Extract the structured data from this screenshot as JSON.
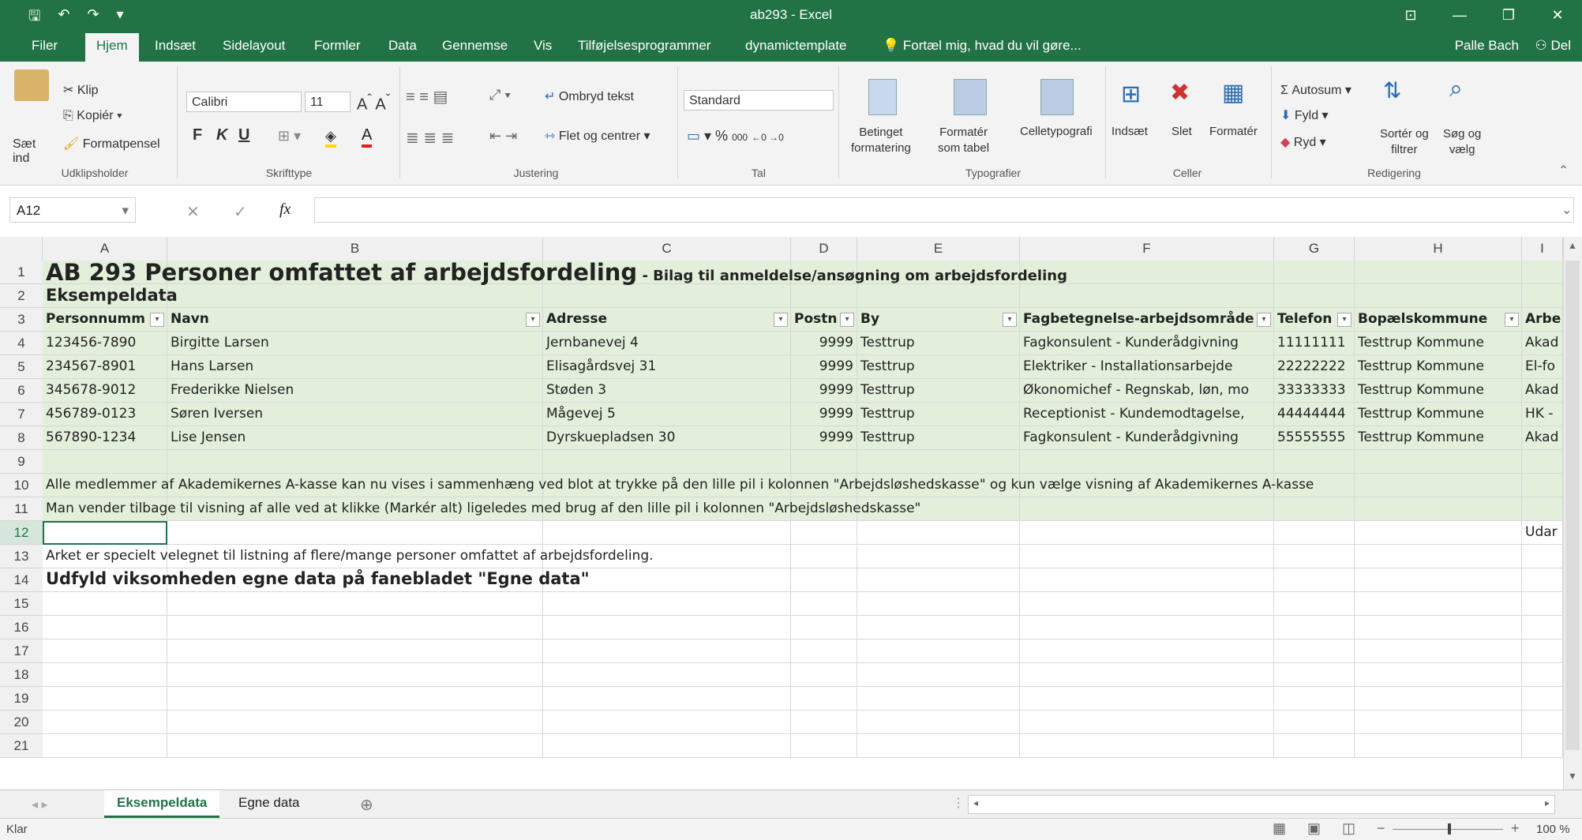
{
  "window": {
    "title": "ab293 - Excel"
  },
  "menu": {
    "tabs": [
      "Filer",
      "Hjem",
      "Indsæt",
      "Sidelayout",
      "Formler",
      "Data",
      "Gennemse",
      "Vis",
      "Tilføjelsesprogrammer",
      "dynamictemplate"
    ],
    "tellme": "Fortæl mig, hvad du vil gøre...",
    "user": "Palle Bach",
    "share": "Del"
  },
  "ribbon": {
    "paste": "Sæt\nind",
    "clip": "Klip",
    "copy": "Kopiér",
    "painter": "Formatpensel",
    "group_clipboard": "Udklipsholder",
    "font_name": "Calibri",
    "font_size": "11",
    "group_font": "Skrifttype",
    "wrap": "Ombryd tekst",
    "merge": "Flet og centrer",
    "group_align": "Justering",
    "numformat": "Standard",
    "group_number": "Tal",
    "cond_format": "Betinget\nformatering",
    "format_table": "Formatér\nsom tabel",
    "cell_styles": "Celletypografi",
    "group_styles": "Typografier",
    "insert": "Indsæt",
    "delete": "Slet",
    "format": "Formatér",
    "group_cells": "Celler",
    "autosum": "Autosum",
    "fill": "Fyld",
    "clear": "Ryd",
    "sort": "Sortér og\nfiltrer",
    "find": "Søg og\nvælg",
    "group_edit": "Redigering"
  },
  "formula": {
    "namebox": "A12",
    "fx": "fx",
    "content": ""
  },
  "grid": {
    "columns": [
      "A",
      "B",
      "C",
      "D",
      "E",
      "F",
      "G",
      "H",
      "I"
    ],
    "row_numbers": [
      "1",
      "2",
      "3",
      "4",
      "5",
      "6",
      "7",
      "8",
      "9",
      "10",
      "11",
      "12",
      "13",
      "14",
      "15",
      "16",
      "17",
      "18",
      "19",
      "20",
      "21"
    ],
    "title_main": "AB 293 Personer omfattet af arbejdsfordeling",
    "title_sub": " - Bilag til anmeldelse/ansøgning om arbejdsfordeling",
    "row2": "Eksempeldata",
    "headers": [
      "Personnumm",
      "Navn",
      "Adresse",
      "Postn",
      "By",
      "Fagbetegnelse-arbejdsområde",
      "Telefon",
      "Bopælskommune",
      "Arbe"
    ],
    "rows": [
      [
        "123456-7890",
        "Birgitte Larsen",
        "Jernbanevej 4",
        "9999",
        "Testtrup",
        "Fagkonsulent - Kunderådgivning",
        "11111111",
        "Testtrup Kommune",
        "Akad"
      ],
      [
        "234567-8901",
        "Hans Larsen",
        "Elisagårdsvej 31",
        "9999",
        "Testtrup",
        "Elektriker - Installationsarbejde",
        "22222222",
        "Testtrup Kommune",
        "El-fo"
      ],
      [
        "345678-9012",
        "Frederikke Nielsen",
        "Støden 3",
        "9999",
        "Testtrup",
        "Økonomichef - Regnskab, løn, mo",
        "33333333",
        "Testtrup Kommune",
        "Akad"
      ],
      [
        "456789-0123",
        "Søren Iversen",
        "Mågevej 5",
        "9999",
        "Testtrup",
        "Receptionist - Kundemodtagelse,",
        "44444444",
        "Testtrup Kommune",
        "HK -"
      ],
      [
        "567890-1234",
        "Lise Jensen",
        "Dyrskuepladsen 30",
        "9999",
        "Testtrup",
        "Fagkonsulent - Kunderådgivning",
        "55555555",
        "Testtrup Kommune",
        "Akad"
      ]
    ],
    "row10": "Alle medlemmer af Akademikernes A-kasse kan nu vises i sammenhæng ved blot at trykke på den lille pil i kolonnen \"Arbejdsløshedskasse\" og kun vælge visning af Akademikernes A-kasse",
    "row11": "Man vender tilbage til visning af alle ved at klikke (Markér alt) ligeledes med brug af den lille pil i kolonnen \"Arbejdsløshedskasse\"",
    "row12_i": "Udar",
    "row13": "Arket er specielt velegnet til listning af flere/mange personer omfattet af arbejdsfordeling.",
    "row14": "Udfyld viksomheden egne data på fanebladet \"Egne data\""
  },
  "sheets": {
    "tabs": [
      "Eksempeldata",
      "Egne data"
    ],
    "active": "Eksempeldata"
  },
  "status": {
    "left": "Klar",
    "zoom": "100 %"
  },
  "colors": {
    "excel_green": "#217346",
    "table_fill": "#e2efda"
  }
}
